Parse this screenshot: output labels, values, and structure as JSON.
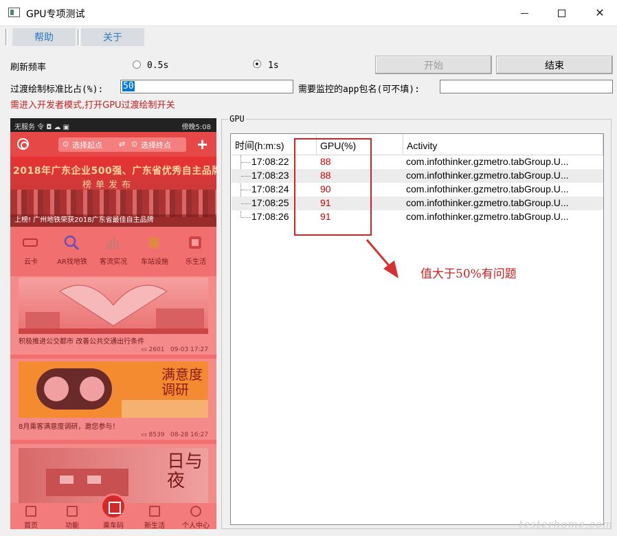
{
  "window": {
    "title": "GPU专项测试"
  },
  "menu": {
    "items": [
      "帮助",
      "关于"
    ]
  },
  "controls": {
    "refresh_label": "刷新频率",
    "opt_05": "0.5s",
    "opt_1": "1s",
    "selected": "1s",
    "start_label": "开始",
    "stop_label": "结束",
    "overdraw_label": "过渡绘制标准比占(%):",
    "overdraw_value": "50",
    "pkg_label": "需要监控的app包名(可不填):",
    "pkg_value": "",
    "warning": "需进入开发者模式,打开GPU过渡绘制开关"
  },
  "phone": {
    "status_left": "无服务 令 ◘ ☁ ▣",
    "status_right": "傍晚5:08",
    "search_from": "选择起点",
    "search_to": "选择终点",
    "banner_title": "2018年广东企业500强、广东省优秀自主品牌",
    "banner_sub": "榜单发布",
    "banner_caption": "上榜! 广州地铁荣获2018广东省最佳自主品牌",
    "icons": [
      "云卡",
      "AR找地铁",
      "客流实况",
      "车站设施",
      "乐生活"
    ],
    "cards": [
      {
        "caption": "积极推进公交都市 改善公共交通出行条件",
        "views": "2601",
        "date": "09-03 17:27"
      },
      {
        "caption": "8月乘客满意度调研，邀您参与！",
        "views": "8539",
        "date": "08-28 16:27"
      }
    ],
    "poster_text": "满意度调研",
    "poster3_text": "日与夜",
    "nav": [
      "首页",
      "功能",
      "乘车码",
      "新生活",
      "个人中心"
    ]
  },
  "gpu": {
    "group_title": "GPU",
    "columns": [
      "时间(h:m:s)",
      "GPU(%)",
      "Activity"
    ],
    "rows": [
      {
        "time": "17:08:22",
        "gpu": "88",
        "activity": "com.infothinker.gzmetro.tabGroup.U..."
      },
      {
        "time": "17:08:23",
        "gpu": "88",
        "activity": "com.infothinker.gzmetro.tabGroup.U..."
      },
      {
        "time": "17:08:24",
        "gpu": "90",
        "activity": "com.infothinker.gzmetro.tabGroup.U..."
      },
      {
        "time": "17:08:25",
        "gpu": "91",
        "activity": "com.infothinker.gzmetro.tabGroup.U..."
      },
      {
        "time": "17:08:26",
        "gpu": "91",
        "activity": "com.infothinker.gzmetro.tabGroup.U..."
      }
    ]
  },
  "annotation": {
    "text": "值大于50%有问题",
    "color": "#d02020"
  },
  "watermark": "testerhome.com"
}
